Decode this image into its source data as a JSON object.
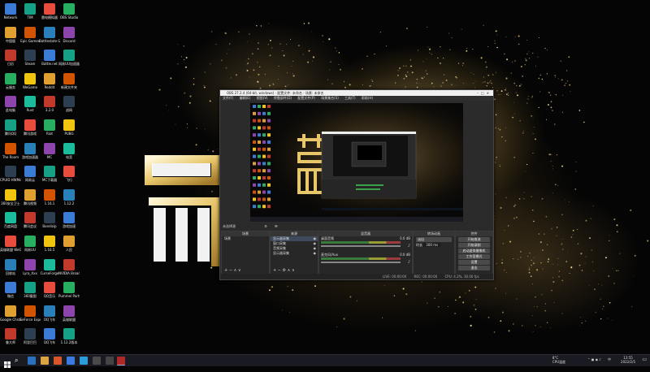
{
  "desktop": {
    "col1": [
      "Network",
      "中国版",
      "日历",
      "云服务",
      "此电脑",
      "腾讯QQ",
      "The Room",
      "CPUID HWMonitor",
      "360安全卫士",
      "百度网盘",
      "英雄联盟 WeGame版",
      "回收站",
      "微信",
      "Google Chrome",
      "鲁大师"
    ],
    "col2": [
      "TIM",
      "Epic Games",
      "Steam",
      "WeGame",
      "Rust",
      "腾讯游戏",
      "游戏加速器",
      "网易云",
      "腾讯视频",
      "腾讯会议",
      "网易UU",
      "Lyra_Xxx",
      "360截图",
      "GeForce Experience",
      "阿里巴巴"
    ],
    "col3": [
      "雷电模拟器",
      "Battlestate Games",
      "Battle.net",
      "Reddit",
      "3.2.0",
      "Riot",
      "MC",
      "MC下载器",
      "1.16.1",
      "Bandizip",
      "1.16.5",
      "CurseForge",
      "QQ音乐",
      "OQ飞车",
      "QQ飞车"
    ],
    "col4": [
      "OBS Studio",
      "Discord",
      "网易UU加速器",
      "新建文件夹",
      "战网",
      "PUBG",
      "电竞",
      "飞行",
      "1.12.2",
      "游戏加速",
      "人民",
      "NVIDIA Broadcast",
      "Pummel Party",
      "英雄联盟",
      "1.12.2版本"
    ]
  },
  "obs": {
    "title": "OBS 27.2.4 (64-bit, windows) - 配置文件: 未命名 - 场景: 未命名",
    "menu": [
      "文件(F)",
      "编辑(E)",
      "视图(V)",
      "停靠部件(D)",
      "配置文件(P)",
      "场景集合(S)",
      "工具(T)",
      "帮助(H)"
    ],
    "source_label": "未选择源",
    "docks": {
      "scenes": {
        "title": "场景",
        "items": [
          "场景"
        ]
      },
      "sources": {
        "title": "来源",
        "items": [
          "显示器采集",
          "窗口采集",
          "音频采集",
          "显示器采集"
        ]
      },
      "mixer": {
        "title": "混音器",
        "ch1": "桌面音频",
        "ch2": "麦克风/Aux",
        "db1": "0.0 dB",
        "db2": "0.0 dB"
      },
      "transitions": {
        "title": "转场动画",
        "type": "淡出",
        "duration_label": "时长",
        "duration": "300 ms"
      },
      "controls": {
        "title": "控件",
        "buttons": [
          "开始推流",
          "开始录制",
          "启动虚拟摄像机",
          "工作室模式",
          "设置",
          "退出"
        ]
      }
    },
    "status": {
      "live": "LIVE: 00:00:00",
      "rec": "REC: 00:00:00",
      "cpu": "CPU: 4.2%, 30.00 fps"
    }
  },
  "taskbar": {
    "temp": "8°C",
    "weather": "CPU温度",
    "time": "13:55",
    "date": "2022/2/5",
    "lang": "中"
  }
}
